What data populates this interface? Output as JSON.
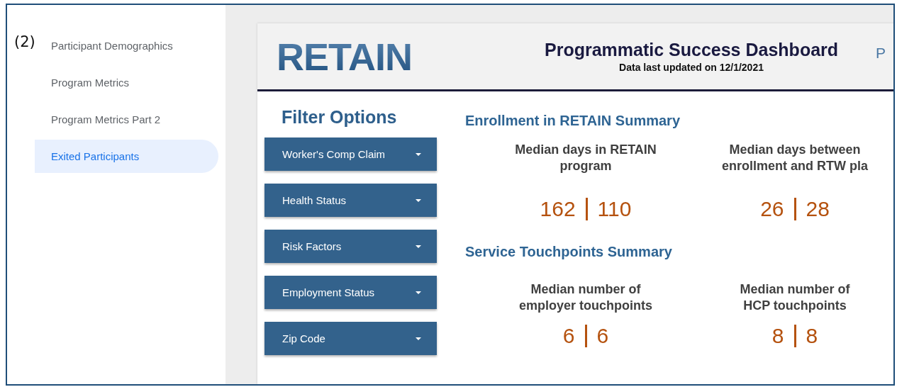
{
  "figure_label": "(2)",
  "sidebar": {
    "items": [
      {
        "label": "Participant Demographics",
        "selected": false
      },
      {
        "label": "Program Metrics",
        "selected": false
      },
      {
        "label": "Program Metrics Part 2",
        "selected": false
      },
      {
        "label": "Exited Participants",
        "selected": true
      }
    ]
  },
  "header": {
    "logo": "RETAIN",
    "title": "Programmatic Success Dashboard",
    "subtitle": "Data last updated on 12/1/2021",
    "nav_cut": "P"
  },
  "filters": {
    "title": "Filter Options",
    "items": [
      "Worker's Comp Claim",
      "Health Status",
      "Risk Factors",
      "Employment Status",
      "Zip Code"
    ]
  },
  "sections": [
    {
      "title": "Enrollment in RETAIN Summary",
      "metrics": [
        {
          "label_lines": [
            "Median days in RETAIN",
            "program"
          ],
          "values": [
            "162",
            "110"
          ]
        },
        {
          "label_lines": [
            "Median days between",
            "enrollment and RTW pla"
          ],
          "values": [
            "26",
            "28"
          ]
        }
      ]
    },
    {
      "title": "Service Touchpoints Summary",
      "metrics": [
        {
          "label_lines": [
            "Median number of",
            "employer touchpoints"
          ],
          "values": [
            "6",
            "6"
          ]
        },
        {
          "label_lines": [
            "Median number of",
            "HCP touchpoints"
          ],
          "values": [
            "8",
            "8"
          ]
        }
      ]
    }
  ]
}
